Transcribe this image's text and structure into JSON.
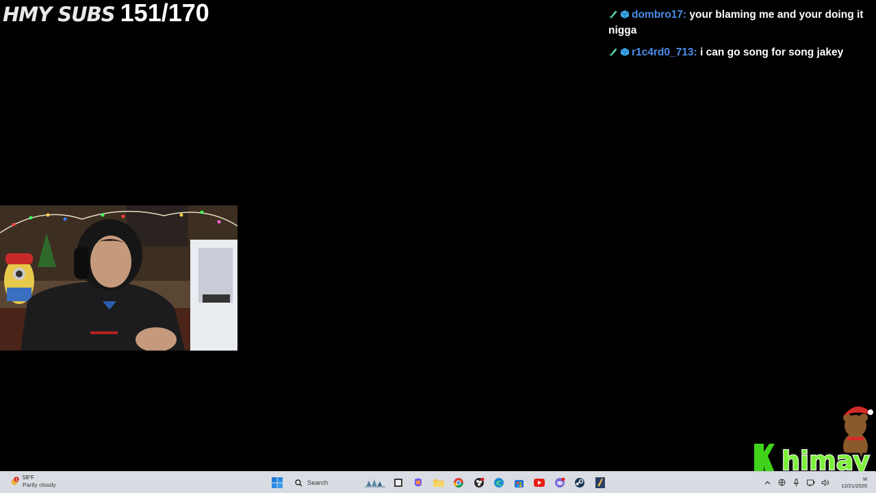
{
  "overlay": {
    "subgoal_label": "HMY SUBS",
    "subgoal_count": "151/170"
  },
  "chat": {
    "messages": [
      {
        "user": "dombro17:",
        "text_line1": "your blaming me and your doing it",
        "text_line2": "nigga"
      },
      {
        "user": "r1c4rd0_713:",
        "text_line1": "i can go song for song jakey",
        "text_line2": ""
      }
    ]
  },
  "webcam": {
    "subject": "streamer-webcam-feed"
  },
  "brand": {
    "logo_text": "himay"
  },
  "taskbar": {
    "weather": {
      "temp": "58°F",
      "condition": "Partly cloudy",
      "alert_count": "1"
    },
    "search_placeholder": "Search",
    "apps": [
      "file-explorer-icon",
      "copilot-icon",
      "folder-icon",
      "chrome-icon",
      "obs-icon",
      "edge-icon",
      "store-icon",
      "youtube-icon",
      "discord-icon",
      "steam-icon",
      "app-icon"
    ],
    "clock": {
      "time": "M",
      "date": "12/21/2025"
    }
  },
  "colors": {
    "chat_username": "#4a8de9",
    "taskbar_bg": "#d9dde3",
    "brand_green": "#5cd63a"
  }
}
